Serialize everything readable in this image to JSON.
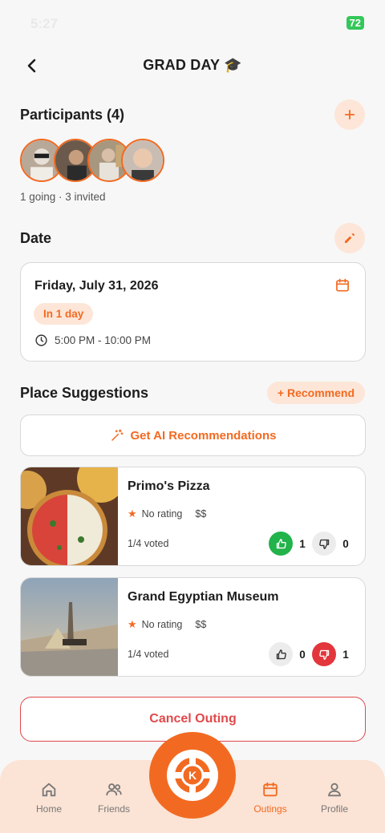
{
  "status_bar": {
    "time": "5:27",
    "battery": "72"
  },
  "header": {
    "title": "GRAD DAY 🎓",
    "back_icon": "chevron-left-icon"
  },
  "participants": {
    "title": "Participants (4)",
    "summary": "1 going · 3 invited",
    "add_icon": "plus-icon"
  },
  "date": {
    "title": "Date",
    "date_text": "Friday, July 31, 2026",
    "badge": "In 1 day",
    "time_range": "5:00 PM - 10:00 PM",
    "edit_icon": "pencil-icon"
  },
  "suggestions": {
    "title": "Place Suggestions",
    "recommend_label": "+ Recommend",
    "ai_label": "Get AI Recommendations",
    "places": [
      {
        "name": "Primo's Pizza",
        "rating": "No rating",
        "price": "$$",
        "voted": "1/4 voted",
        "up": "1",
        "down": "0",
        "user_vote": "up"
      },
      {
        "name": "Grand Egyptian Museum",
        "rating": "No rating",
        "price": "$$",
        "voted": "1/4 voted",
        "up": "0",
        "down": "1",
        "user_vote": "down"
      }
    ]
  },
  "cancel_label": "Cancel Outing",
  "nav": {
    "home": "Home",
    "friends": "Friends",
    "outings": "Outings",
    "profile": "Profile",
    "active": "Outings"
  },
  "colors": {
    "accent": "#f26a21",
    "accent_light": "#fde6d8",
    "danger": "#e0494b",
    "success": "#22b34a"
  }
}
